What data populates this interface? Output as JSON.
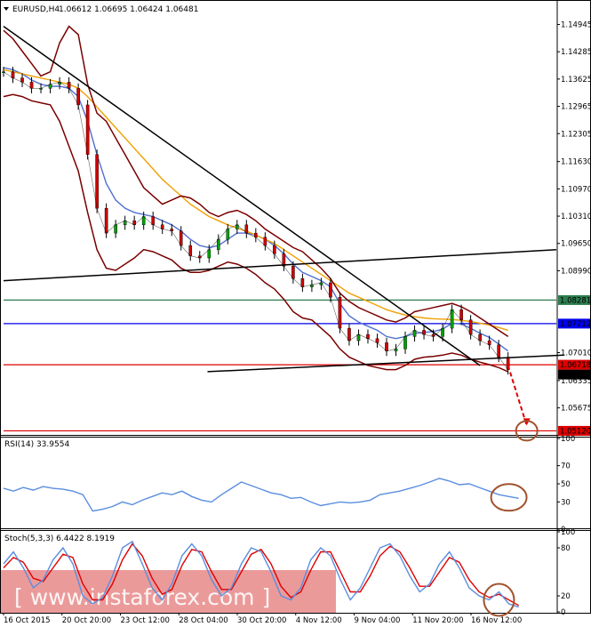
{
  "chart_data": [
    {
      "type": "line",
      "panel": "price",
      "symbol_header": "EURUSD,H4",
      "ohlc_header": "1.06612 1.06695 1.06424 1.06481",
      "ohlc": {
        "open": 1.06612,
        "high": 1.06695,
        "low": 1.06424,
        "close": 1.06481
      },
      "y_ticks": [
        1.14945,
        1.14285,
        1.13625,
        1.12965,
        1.12305,
        1.1163,
        1.1097,
        1.1031,
        1.0965,
        1.0899,
        1.0701,
        1.06335,
        1.05675
      ],
      "y_tick_labels": [
        "1.14945",
        "1.14285",
        "1.13625",
        "1.12965",
        "1.12305",
        "1.11630",
        "1.10970",
        "1.10310",
        "1.09650",
        "1.08990",
        "1.07010",
        "1.06335",
        "1.05675"
      ],
      "ylim": [
        1.05,
        1.1545
      ],
      "horizontal_levels": [
        {
          "value": 1.08281,
          "label": "1.08281",
          "color": "#2e7d4f"
        },
        {
          "value": 1.07712,
          "label": "1.07712",
          "color": "#0000ee"
        },
        {
          "value": 1.06718,
          "label": "1.06718",
          "color": "#dd0000"
        },
        {
          "value": 1.06481,
          "label": "1.06481",
          "color": "#000000"
        },
        {
          "value": 1.0512,
          "label": "1.05120",
          "color": "#dd0000"
        }
      ],
      "series": [
        {
          "kind": "price",
          "color": "#000000",
          "values": [
            1.138,
            1.1365,
            1.1355,
            1.134,
            1.134,
            1.135,
            1.1355,
            1.134,
            1.13,
            1.118,
            1.105,
            1.099,
            1.101,
            1.102,
            1.101,
            1.103,
            1.101,
            1.1,
            1.0995,
            1.096,
            1.0935,
            1.093,
            1.095,
            1.0975,
            1.1,
            1.101,
            1.099,
            1.098,
            1.096,
            1.094,
            1.091,
            1.088,
            1.086,
            1.0865,
            1.087,
            1.0835,
            1.076,
            1.073,
            1.0745,
            1.0735,
            1.0725,
            1.0705,
            1.071,
            1.074,
            1.0755,
            1.0745,
            1.074,
            1.076,
            1.0805,
            1.078,
            1.0745,
            1.073,
            1.072,
            1.069,
            1.066
          ]
        },
        {
          "kind": "moving-average-fast",
          "color": "#5070d0",
          "values": [
            1.139,
            1.1385,
            1.1375,
            1.136,
            1.135,
            1.1345,
            1.1345,
            1.134,
            1.132,
            1.126,
            1.118,
            1.111,
            1.107,
            1.105,
            1.104,
            1.1035,
            1.103,
            1.102,
            1.101,
            1.0995,
            1.0975,
            1.096,
            1.0955,
            1.096,
            1.0975,
            1.099,
            1.099,
            1.0985,
            1.0975,
            1.096,
            1.094,
            1.0915,
            1.0895,
            1.0885,
            1.0875,
            1.086,
            1.082,
            1.079,
            1.0775,
            1.0765,
            1.0755,
            1.074,
            1.0735,
            1.074,
            1.0748,
            1.075,
            1.0752,
            1.0758,
            1.0772,
            1.077,
            1.076,
            1.0748,
            1.0738,
            1.0722,
            1.0705
          ]
        },
        {
          "kind": "moving-average-slow",
          "color": "#f0a000",
          "values": [
            1.1385,
            1.138,
            1.1375,
            1.137,
            1.1365,
            1.136,
            1.1355,
            1.135,
            1.134,
            1.132,
            1.1295,
            1.127,
            1.1245,
            1.122,
            1.1195,
            1.117,
            1.1145,
            1.112,
            1.11,
            1.108,
            1.106,
            1.1045,
            1.103,
            1.102,
            1.101,
            1.1002,
            1.0995,
            1.0985,
            1.0975,
            1.0965,
            1.095,
            1.0935,
            1.092,
            1.0905,
            1.089,
            1.0875,
            1.086,
            1.0845,
            1.0835,
            1.0825,
            1.0815,
            1.0805,
            1.0798,
            1.0792,
            1.0788,
            1.0785,
            1.0783,
            1.0782,
            1.0781,
            1.0779,
            1.0776,
            1.0772,
            1.0768,
            1.0762,
            1.0755
          ]
        },
        {
          "kind": "bollinger-upper",
          "color": "#7a0000",
          "values": [
            1.148,
            1.146,
            1.143,
            1.14,
            1.137,
            1.138,
            1.145,
            1.149,
            1.147,
            1.135,
            1.128,
            1.126,
            1.122,
            1.118,
            1.114,
            1.11,
            1.108,
            1.106,
            1.107,
            1.108,
            1.1075,
            1.106,
            1.104,
            1.103,
            1.104,
            1.1045,
            1.1035,
            1.102,
            1.1,
            1.0985,
            1.097,
            1.0955,
            1.0945,
            1.0925,
            1.0905,
            1.088,
            1.0845,
            1.0825,
            1.081,
            1.08,
            1.079,
            1.078,
            1.0775,
            1.0785,
            1.08,
            1.0805,
            1.081,
            1.0815,
            1.082,
            1.0812,
            1.08,
            1.0785,
            1.077,
            1.0755,
            1.074
          ]
        },
        {
          "kind": "bollinger-lower",
          "color": "#7a0000",
          "values": [
            1.132,
            1.1325,
            1.132,
            1.131,
            1.1305,
            1.13,
            1.126,
            1.12,
            1.114,
            1.104,
            1.095,
            1.0905,
            1.09,
            1.0915,
            1.093,
            1.095,
            1.0945,
            1.0935,
            1.0925,
            1.0905,
            1.0895,
            1.0895,
            1.09,
            1.091,
            1.092,
            1.0915,
            1.0905,
            1.089,
            1.087,
            1.0855,
            1.083,
            1.08,
            1.0785,
            1.078,
            1.076,
            1.074,
            1.071,
            1.069,
            1.068,
            1.067,
            1.0665,
            1.066,
            1.066,
            1.067,
            1.0685,
            1.069,
            1.0692,
            1.0695,
            1.07,
            1.0695,
            1.0685,
            1.0678,
            1.0672,
            1.0665,
            1.0655
          ]
        }
      ],
      "annotations": [
        {
          "kind": "trendline",
          "color": "#000000",
          "from": [
            0,
            1.149
          ],
          "to": [
            51,
            1.067
          ]
        },
        {
          "kind": "trendline",
          "color": "#000000",
          "from": [
            0,
            1.0875
          ],
          "to": [
            104,
            1.095
          ]
        },
        {
          "kind": "trendline",
          "color": "#000000",
          "from": [
            38,
            1.0655
          ],
          "to": [
            60,
            1.0695
          ]
        },
        {
          "kind": "forecast-arrow",
          "color": "#e00000",
          "from": [
            54,
            1.067
          ],
          "to": [
            56,
            1.0525
          ]
        },
        {
          "kind": "circle",
          "color": "#a0522d",
          "center": [
            56,
            1.0512
          ]
        }
      ]
    },
    {
      "type": "line",
      "panel": "rsi",
      "header": "RSI(14) 33.9554",
      "ylim": [
        0,
        100
      ],
      "y_ticks": [
        100,
        70,
        50,
        30,
        0
      ],
      "y_tick_labels": [
        "100",
        "70",
        "50",
        "30",
        "0"
      ],
      "series": [
        {
          "kind": "rsi",
          "color": "#5a8ee0",
          "values": [
            45,
            42,
            46,
            43,
            47,
            45,
            44,
            42,
            38,
            20,
            22,
            25,
            30,
            27,
            32,
            36,
            40,
            38,
            42,
            36,
            32,
            30,
            38,
            45,
            52,
            48,
            44,
            40,
            38,
            34,
            35,
            30,
            26,
            28,
            30,
            29,
            30,
            32,
            38,
            40,
            42,
            45,
            48,
            52,
            56,
            53,
            49,
            50,
            46,
            42,
            38,
            36,
            34
          ]
        }
      ],
      "annotations": [
        {
          "kind": "circle",
          "color": "#a0522d",
          "center": [
            51,
            35
          ]
        }
      ]
    },
    {
      "type": "line",
      "panel": "stochastic",
      "header": "Stoch(5,3,3) 6.4422 8.1919",
      "ylim": [
        0,
        100
      ],
      "y_ticks": [
        100,
        80,
        20,
        0
      ],
      "y_tick_labels": [
        "100",
        "80",
        "20",
        "0"
      ],
      "series": [
        {
          "kind": "stochastic-main",
          "color": "#5a8ee0",
          "values": [
            60,
            75,
            55,
            30,
            40,
            65,
            80,
            60,
            20,
            10,
            18,
            45,
            80,
            88,
            60,
            30,
            15,
            35,
            70,
            85,
            70,
            40,
            20,
            30,
            60,
            80,
            75,
            50,
            20,
            15,
            30,
            65,
            80,
            70,
            40,
            15,
            30,
            55,
            80,
            85,
            70,
            45,
            25,
            35,
            60,
            75,
            55,
            30,
            20,
            15,
            25,
            10,
            6
          ]
        },
        {
          "kind": "stochastic-signal",
          "color": "#e00000",
          "values": [
            55,
            68,
            62,
            42,
            38,
            55,
            72,
            68,
            35,
            15,
            15,
            35,
            65,
            85,
            70,
            42,
            22,
            28,
            58,
            78,
            75,
            50,
            28,
            28,
            50,
            72,
            78,
            60,
            32,
            18,
            25,
            52,
            75,
            75,
            50,
            25,
            25,
            45,
            70,
            82,
            75,
            55,
            32,
            32,
            50,
            68,
            62,
            40,
            25,
            18,
            22,
            15,
            8
          ]
        }
      ],
      "annotations": [
        {
          "kind": "circle",
          "color": "#a0522d",
          "center": [
            50,
            15
          ]
        }
      ]
    }
  ],
  "x_axis": {
    "labels": [
      "16 Oct 2015",
      "20 Oct 20:00",
      "23 Oct 12:00",
      "28 Oct 04:00",
      "30 Oct 20:00",
      "4 Nov 12:00",
      "9 Nov 04:00",
      "11 Nov 20:00",
      "16 Nov 12:00"
    ]
  },
  "watermark": "[ www.instaforex.com ]",
  "colors": {
    "axis": "#000000",
    "candle_up": "#00a000",
    "candle_down": "#d00000",
    "watermark_band": "#e88888"
  }
}
